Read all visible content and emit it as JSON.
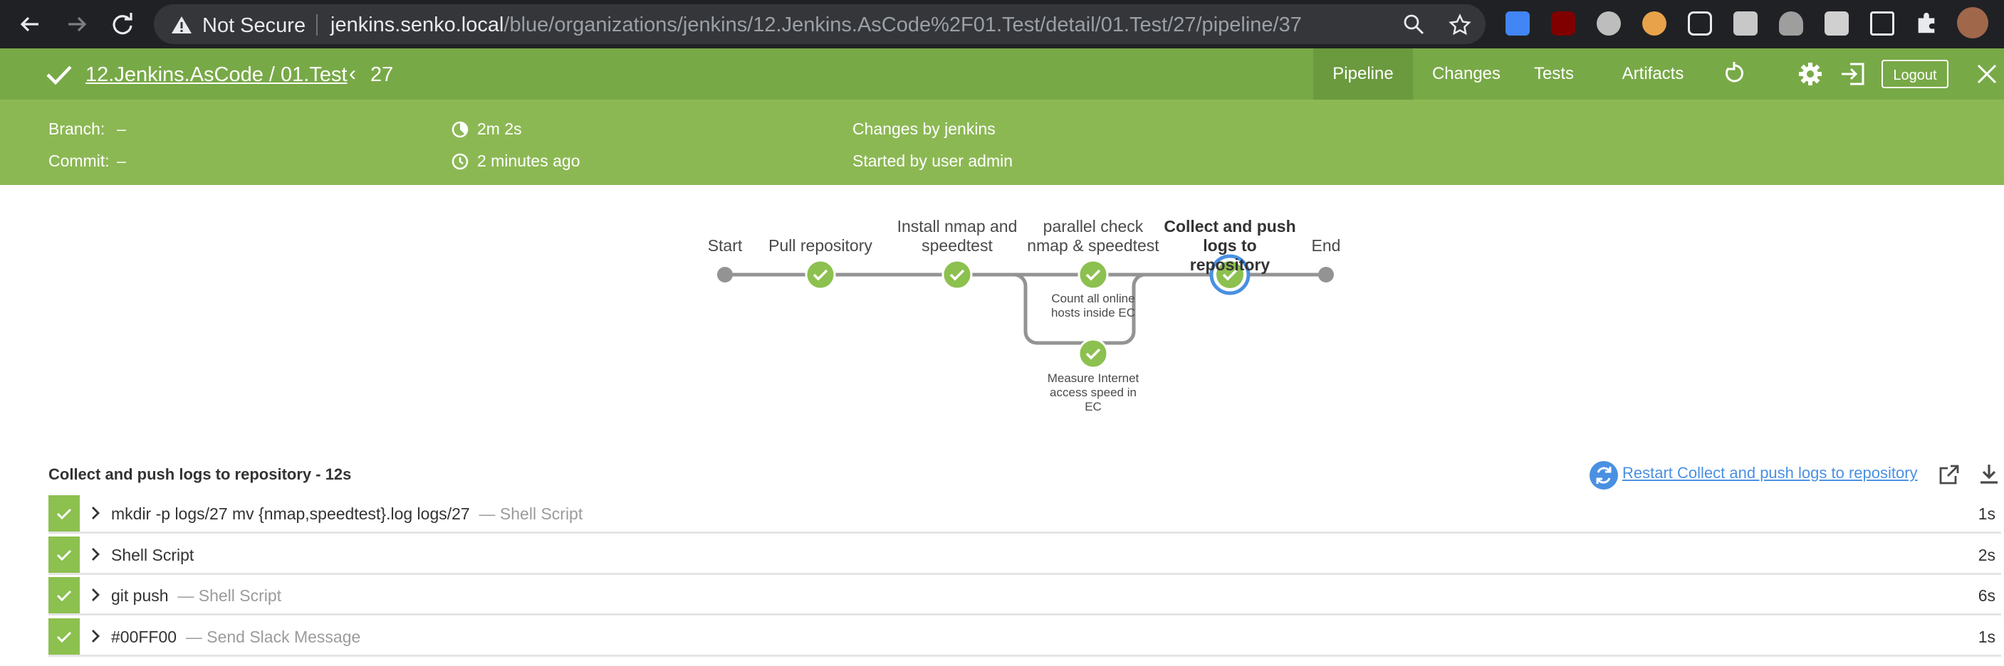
{
  "browser": {
    "security_label": "Not Secure",
    "url_host": "jenkins.senko.local",
    "url_path": "/blue/organizations/jenkins/12.Jenkins.AsCode%2F01.Test/detail/01.Test/27/pipeline/37"
  },
  "header": {
    "title": "12.Jenkins.AsCode / 01.Test",
    "run_number": "27",
    "tabs": [
      "Pipeline",
      "Changes",
      "Tests",
      "Artifacts"
    ],
    "logout_label": "Logout",
    "branch_label": "Branch:",
    "branch_value": "–",
    "commit_label": "Commit:",
    "commit_value": "–",
    "duration": "2m 2s",
    "time_ago": "2 minutes ago",
    "changes_by": "Changes by jenkins",
    "started_by": "Started by user admin",
    "accent_color": "#78a947"
  },
  "pipeline": {
    "stages": [
      {
        "label": "Start"
      },
      {
        "label": "Pull repository"
      },
      {
        "label": "Install nmap and speedtest"
      },
      {
        "label": "parallel check nmap & speedtest"
      },
      {
        "label": "Collect and push logs to repository"
      },
      {
        "label": "End"
      }
    ],
    "parallel_branches": [
      {
        "label": "Count all online hosts inside EC"
      },
      {
        "label": "Measure Internet access speed in EC"
      }
    ]
  },
  "steps_panel": {
    "title": "Collect and push logs to repository - 12s",
    "restart_label": "Restart Collect and push logs to repository",
    "steps": [
      {
        "name": "mkdir -p logs/27 mv {nmap,speedtest}.log logs/27",
        "type": "— Shell Script",
        "duration": "1s"
      },
      {
        "name": "Shell Script",
        "type": "",
        "duration": "2s"
      },
      {
        "name": "git push",
        "type": "— Shell Script",
        "duration": "6s"
      },
      {
        "name": "#00FF00",
        "type": "— Send Slack Message",
        "duration": "1s"
      }
    ]
  }
}
